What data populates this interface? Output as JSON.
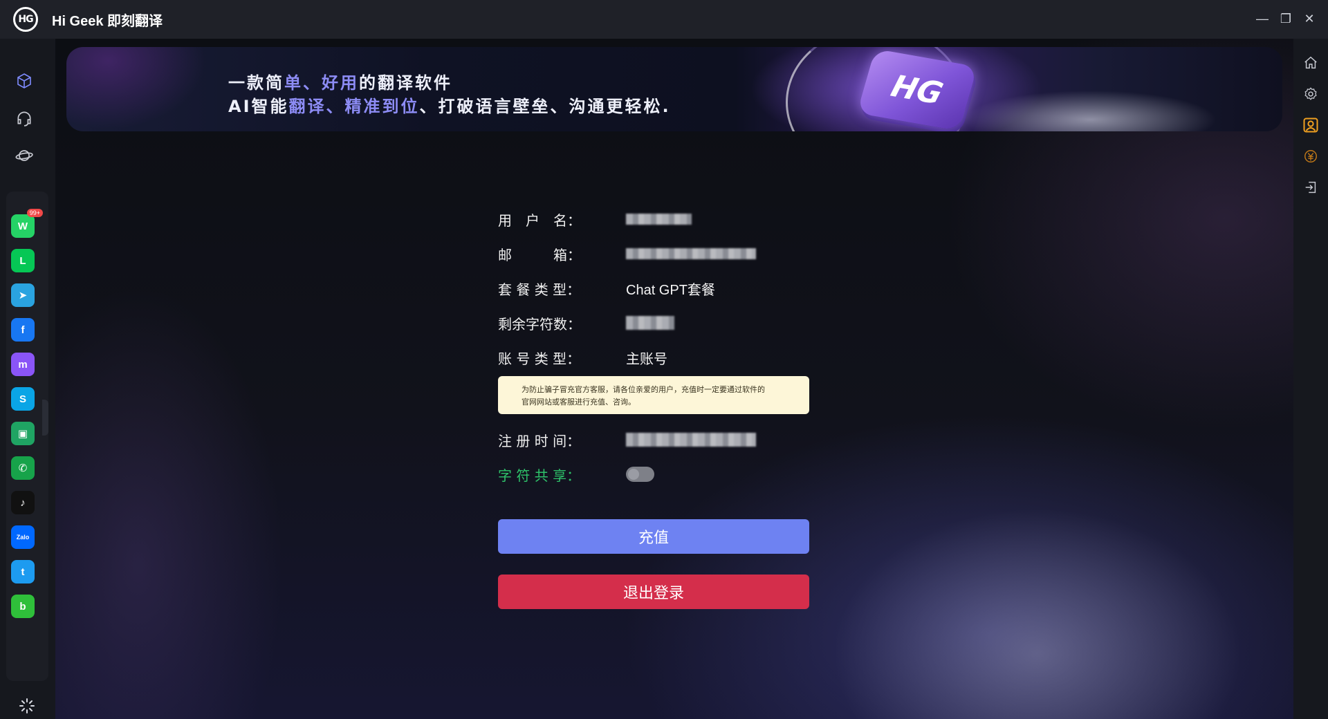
{
  "window": {
    "logo_text": "HG",
    "title": "Hi Geek 即刻翻译",
    "controls": {
      "minimize": "—",
      "restore": "❐",
      "close": "✕"
    }
  },
  "left_nav": {
    "icons": [
      "cube-icon",
      "headset-icon",
      "planet-icon"
    ]
  },
  "apps": [
    {
      "name": "whatsapp",
      "glyph": "W",
      "color": "#25d366",
      "badge": "99+"
    },
    {
      "name": "line",
      "glyph": "L",
      "color": "#06c755"
    },
    {
      "name": "telegram",
      "glyph": "➤",
      "color": "#2aa3e0"
    },
    {
      "name": "facebook",
      "glyph": "f",
      "color": "#1877f2"
    },
    {
      "name": "messenger",
      "glyph": "m",
      "color": "#8a55f7"
    },
    {
      "name": "skype",
      "glyph": "S",
      "color": "#0aa5e6"
    },
    {
      "name": "google-chat",
      "glyph": "▣",
      "color": "#1fa463"
    },
    {
      "name": "phone",
      "glyph": "✆",
      "color": "#17a34a"
    },
    {
      "name": "tiktok",
      "glyph": "♪",
      "color": "#111111"
    },
    {
      "name": "zalo",
      "glyph": "Zalo",
      "color": "#0068ff"
    },
    {
      "name": "twitter",
      "glyph": "t",
      "color": "#1d9bf0"
    },
    {
      "name": "botim",
      "glyph": "b",
      "color": "#2fbf3a"
    }
  ],
  "right_nav": {
    "icons": [
      "home-icon",
      "settings-icon",
      "user-icon",
      "coin-icon",
      "logout-icon"
    ],
    "active": "user-icon"
  },
  "banner": {
    "line1_a": "一款简",
    "line1_hl": "单、好用",
    "line1_b": "的翻译软件",
    "line2_a": "AI智能",
    "line2_hl": "翻译、精准到位",
    "line2_b": "、打破语言壁垒、沟通更轻松.",
    "logo_text": "HG"
  },
  "profile": {
    "username_label": "用　户　名：",
    "email_label": "邮　　　箱：",
    "plan_label": "套 餐 类 型：",
    "plan_value": "Chat GPT套餐",
    "chars_label": "剩余字符数：",
    "account_type_label": "账 号 类 型：",
    "account_type_value": "主账号",
    "notice_line1": "为防止骗子冒充官方客服，请各位亲爱的用户，充值时一定要通过软件的",
    "notice_line2": "官网网站或客服进行充值、咨询。",
    "register_label": "注 册 时 间：",
    "share_label": "字 符 共 享：",
    "share_enabled": false
  },
  "buttons": {
    "recharge": "充值",
    "logout": "退出登录"
  },
  "colors": {
    "accent_blue": "#6e82f2",
    "danger_red": "#d42e4b",
    "share_green": "#2ec36a",
    "active_orange": "#f0a020"
  }
}
